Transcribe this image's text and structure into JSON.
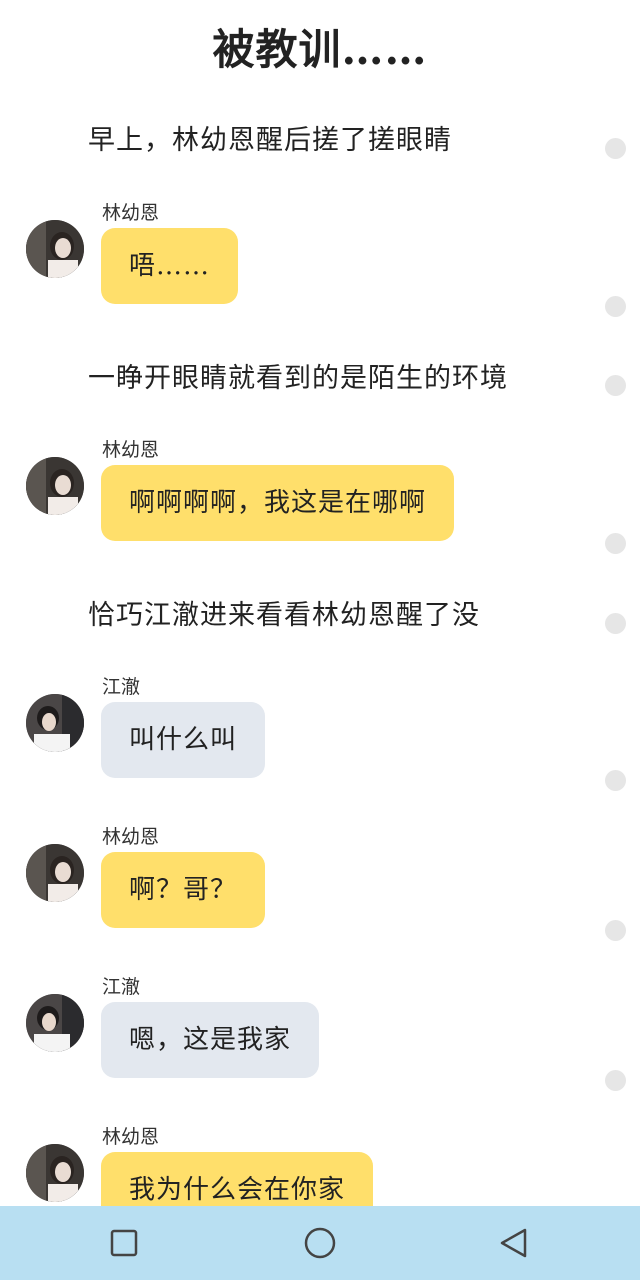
{
  "title": "被教训……",
  "narrations": [
    "早上，林幼恩醒后搓了搓眼睛",
    "一睁开眼睛就看到的是陌生的环境",
    "恰巧江澈进来看看林幼恩醒了没"
  ],
  "messages": [
    {
      "sender": "林幼恩",
      "text": "唔……"
    },
    {
      "sender": "林幼恩",
      "text": "啊啊啊啊，我这是在哪啊"
    },
    {
      "sender": "江澈",
      "text": "叫什么叫"
    },
    {
      "sender": "林幼恩",
      "text": "啊？哥？"
    },
    {
      "sender": "江澈",
      "text": "嗯，这是我家"
    },
    {
      "sender": "林幼恩",
      "text": "我为什么会在你家"
    }
  ],
  "colors": {
    "bubble_self": "#ffdf6b",
    "bubble_other": "#e3e8ef",
    "navbar": "#b8dff2"
  },
  "nav": {
    "recents_icon": "square-icon",
    "home_icon": "circle-icon",
    "back_icon": "triangle-back-icon"
  }
}
